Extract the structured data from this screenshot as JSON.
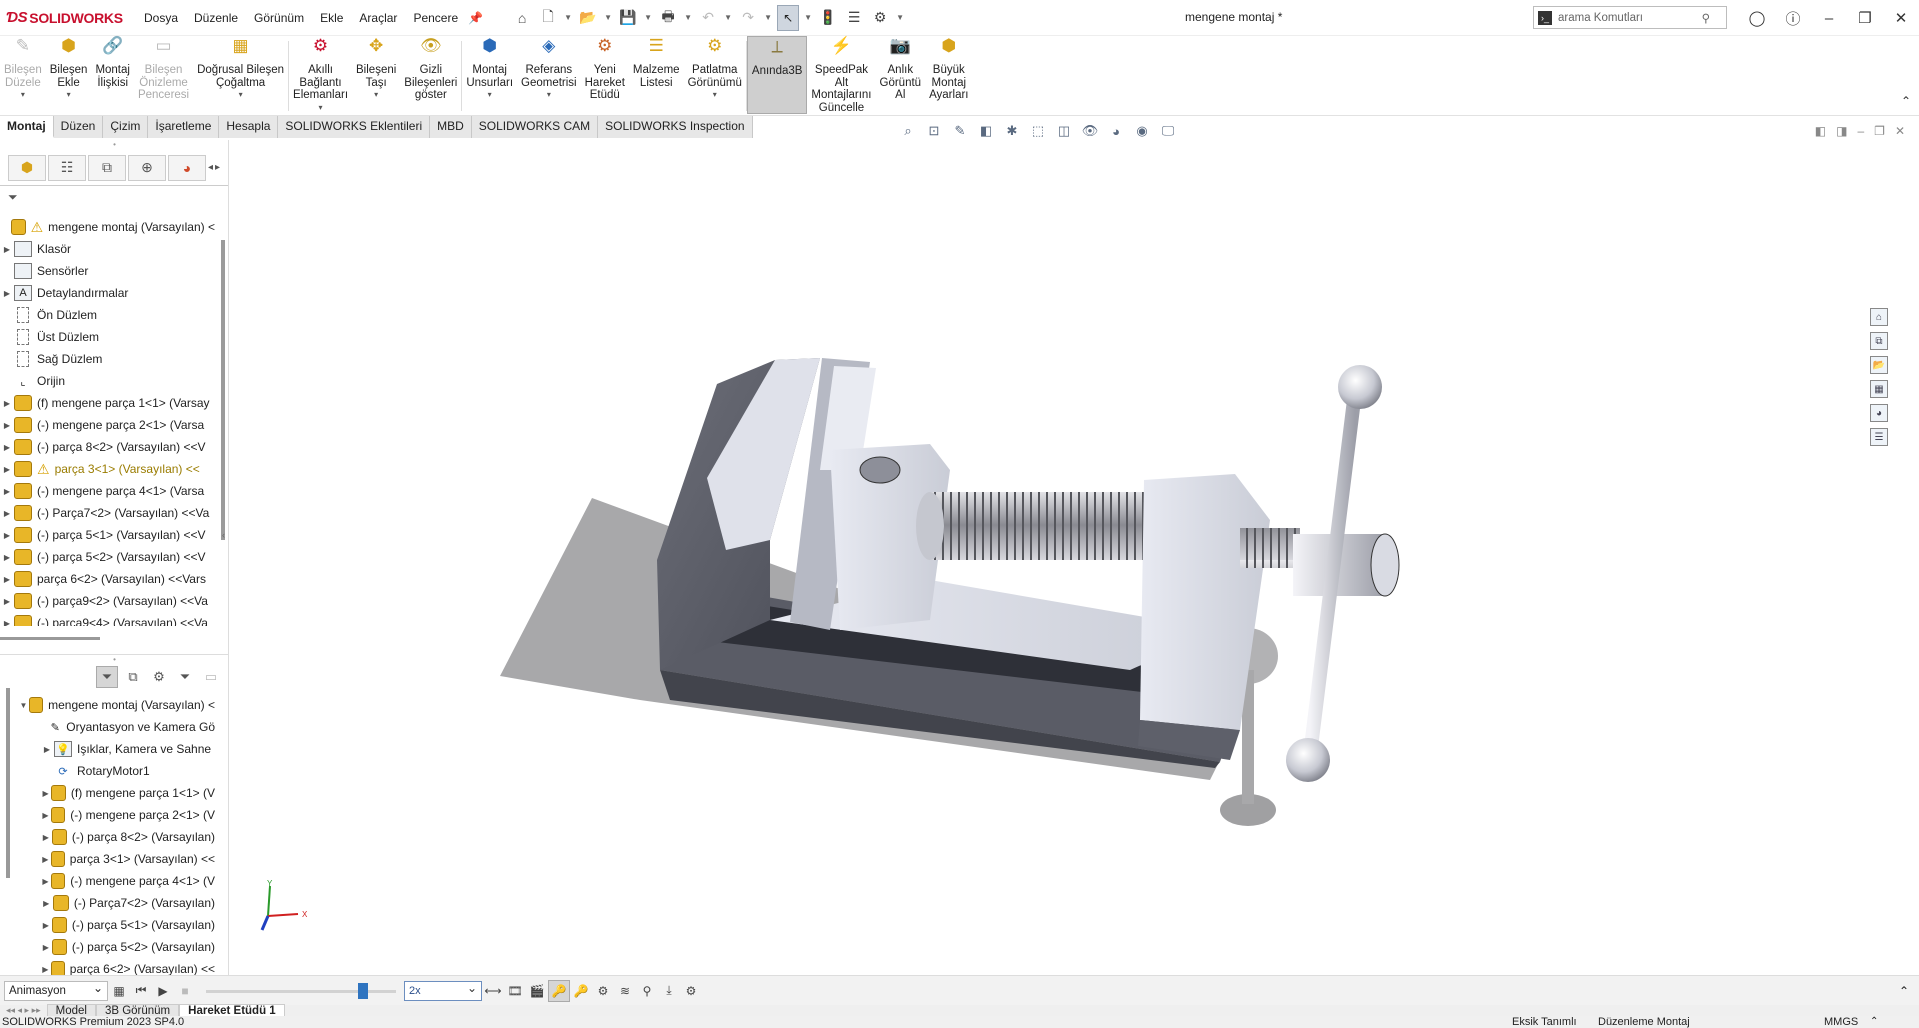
{
  "app": {
    "brand": "SOLIDWORKS",
    "document_title": "mengene montaj *",
    "search_placeholder": "arama Komutları"
  },
  "menu": [
    "Dosya",
    "Düzenle",
    "Görünüm",
    "Ekle",
    "Araçlar",
    "Pencere"
  ],
  "ribbon": [
    {
      "label": "Bileşen\nDüzele",
      "disabled": true,
      "icon": "edit-component-icon"
    },
    {
      "label": "Bileşen\nEkle",
      "icon": "insert-component-icon"
    },
    {
      "label": "Montaj\nİlişkisi",
      "icon": "mate-icon"
    },
    {
      "label": "Bileşen\nÖnizleme\nPenceresi",
      "disabled": true,
      "icon": "preview-window-icon"
    },
    {
      "label": "Doğrusal Bileşen\nÇoğaltma",
      "icon": "pattern-icon"
    },
    {
      "label": "Akıllı\nBağlantı\nElemanları",
      "icon": "smart-fasteners-icon"
    },
    {
      "label": "Bileşeni\nTaşı",
      "icon": "move-component-icon"
    },
    {
      "label": "Gizli\nBileşenleri\ngöster",
      "icon": "show-hidden-icon"
    },
    {
      "label": "Montaj\nUnsurları",
      "icon": "assembly-features-icon"
    },
    {
      "label": "Referans\nGeometrisi",
      "icon": "reference-geometry-icon"
    },
    {
      "label": "Yeni\nHareket\nEtüdü",
      "icon": "new-motion-study-icon"
    },
    {
      "label": "Malzeme\nListesi",
      "icon": "bom-icon"
    },
    {
      "label": "Patlatma\nGörünümü",
      "icon": "exploded-view-icon"
    },
    {
      "label": "Anında3B",
      "active": true,
      "icon": "instant3d-icon"
    },
    {
      "label": "SpeedPak\nAlt\nMontajlarını\nGüncelle",
      "icon": "speedpak-icon"
    },
    {
      "label": "Anlık\nGörüntü\nAl",
      "icon": "snapshot-icon"
    },
    {
      "label": "Büyük\nMontaj\nAyarları",
      "icon": "large-assembly-icon"
    }
  ],
  "tabs": [
    "Montaj",
    "Düzen",
    "Çizim",
    "İşaretleme",
    "Hesapla",
    "SOLIDWORKS Eklentileri",
    "MBD",
    "SOLIDWORKS CAM",
    "SOLIDWORKS Inspection"
  ],
  "feature_tree": [
    {
      "label": "mengene montaj  (Varsayılan) <",
      "type": "root",
      "warn": true
    },
    {
      "label": "Klasör",
      "type": "folder",
      "exp": true
    },
    {
      "label": "Sensörler",
      "type": "folder"
    },
    {
      "label": "Detaylandırmalar",
      "type": "annotation",
      "exp": true
    },
    {
      "label": "Ön Düzlem",
      "type": "plane"
    },
    {
      "label": "Üst Düzlem",
      "type": "plane"
    },
    {
      "label": "Sağ Düzlem",
      "type": "plane"
    },
    {
      "label": "Orijin",
      "type": "origin"
    },
    {
      "label": "(f) mengene parça 1<1> (Varsay",
      "type": "part",
      "exp": true
    },
    {
      "label": "(-) mengene parça 2<1> (Varsa",
      "type": "part",
      "exp": true
    },
    {
      "label": "(-) parça 8<2> (Varsayılan) <<V",
      "type": "part",
      "exp": true
    },
    {
      "label": "parça 3<1> (Varsayılan) <<",
      "type": "part",
      "exp": true,
      "warn": true
    },
    {
      "label": "(-) mengene parça 4<1> (Varsa",
      "type": "part",
      "exp": true
    },
    {
      "label": "(-) Parça7<2> (Varsayılan) <<Va",
      "type": "part",
      "exp": true
    },
    {
      "label": "(-) parça 5<1> (Varsayılan) <<V",
      "type": "part",
      "exp": true
    },
    {
      "label": "(-) parça 5<2> (Varsayılan) <<V",
      "type": "part",
      "exp": true
    },
    {
      "label": "parça 6<2> (Varsayılan) <<Vars",
      "type": "part",
      "exp": true
    },
    {
      "label": "(-) parça9<2> (Varsayılan) <<Va",
      "type": "part",
      "exp": true
    },
    {
      "label": "(-) parça9<4> (Varsayılan) <<Va",
      "type": "part",
      "exp": true
    }
  ],
  "motion_tree": [
    {
      "label": "mengene montaj (Varsayılan) <",
      "type": "root",
      "exp": true,
      "level": 0
    },
    {
      "label": "Oryantasyon ve Kamera Gö",
      "type": "camera",
      "level": 1
    },
    {
      "label": "Işıklar, Kamera ve Sahne",
      "type": "lights",
      "level": 1,
      "exp": true
    },
    {
      "label": "RotaryMotor1",
      "type": "motor",
      "level": 1
    },
    {
      "label": "(f) mengene parça 1<1> (V",
      "type": "part",
      "level": 1,
      "exp": true
    },
    {
      "label": "(-) mengene parça 2<1> (V",
      "type": "part",
      "level": 1,
      "exp": true
    },
    {
      "label": "(-) parça 8<2> (Varsayılan)",
      "type": "part",
      "level": 1,
      "exp": true
    },
    {
      "label": "parça 3<1> (Varsayılan) <<",
      "type": "part",
      "level": 1,
      "exp": true
    },
    {
      "label": "(-) mengene parça 4<1> (V",
      "type": "part",
      "level": 1,
      "exp": true
    },
    {
      "label": "(-) Parça7<2> (Varsayılan)",
      "type": "part",
      "level": 1,
      "exp": true
    },
    {
      "label": "(-) parça 5<1> (Varsayılan)",
      "type": "part",
      "level": 1,
      "exp": true
    },
    {
      "label": "(-) parça 5<2> (Varsayılan)",
      "type": "part",
      "level": 1,
      "exp": true
    },
    {
      "label": "parça 6<2> (Varsayılan) <<",
      "type": "part",
      "level": 1,
      "exp": true
    }
  ],
  "motion_manager": {
    "study_type": "Animasyon",
    "speed": "2x",
    "timeline_position": 0.8
  },
  "bottom_tabs": [
    "Model",
    "3B Görünüm",
    "Hareket Etüdü 1"
  ],
  "status": {
    "left": "SOLIDWORKS Premium 2023 SP4.0",
    "definition": "Eksik Tanımlı",
    "mode": "Düzenleme Montaj",
    "units": "MMGS"
  },
  "triad": {
    "y": "Y",
    "x": "X"
  },
  "colors": {
    "accent": "#c8102e",
    "selection": "#2f74c0"
  }
}
